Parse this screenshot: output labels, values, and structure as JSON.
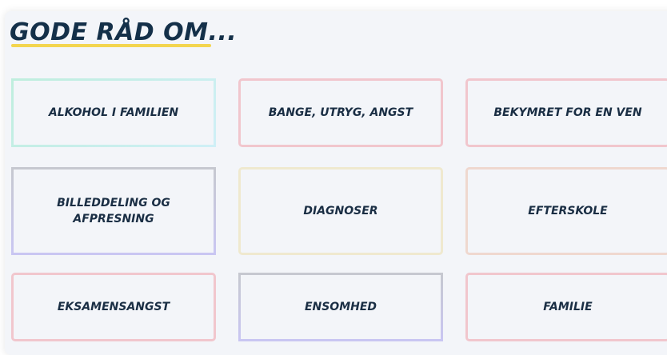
{
  "heading": "GODE RÅD OM...",
  "colors": {
    "heading_text": "#143049",
    "underline": "#f3d54f",
    "panel_background": "#f3f5f9"
  },
  "topics": [
    {
      "label": "ALKOHOL I FAMILIEN"
    },
    {
      "label": "BANGE, UTRYG, ANGST"
    },
    {
      "label": "BEKYMRET FOR EN VEN"
    },
    {
      "label": "BILLEDDELING OG AFPRESNING"
    },
    {
      "label": "DIAGNOSER"
    },
    {
      "label": "EFTERSKOLE"
    },
    {
      "label": "EKSAMENSANGST"
    },
    {
      "label": "ENSOMHED"
    },
    {
      "label": "FAMILIE"
    }
  ]
}
